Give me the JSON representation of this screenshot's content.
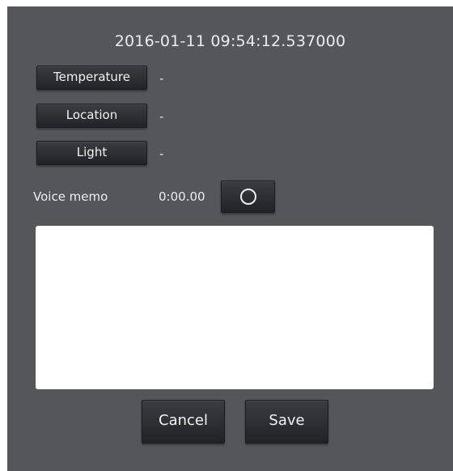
{
  "timestamp": "2016-01-11 09:54:12.537000",
  "sensors": [
    {
      "label": "Temperature",
      "value": "-"
    },
    {
      "label": "Location",
      "value": "-"
    },
    {
      "label": "Light",
      "value": "-"
    }
  ],
  "voice_memo": {
    "label": "Voice memo",
    "time": "0:00.00",
    "record_icon": "record-circle-icon"
  },
  "memo": {
    "value": "",
    "placeholder": ""
  },
  "actions": {
    "cancel_label": "Cancel",
    "save_label": "Save"
  },
  "colors": {
    "dialog_background": "#54565a",
    "button_background": "#2b2c2e",
    "text": "#ececec",
    "memo_background": "#ffffff"
  }
}
